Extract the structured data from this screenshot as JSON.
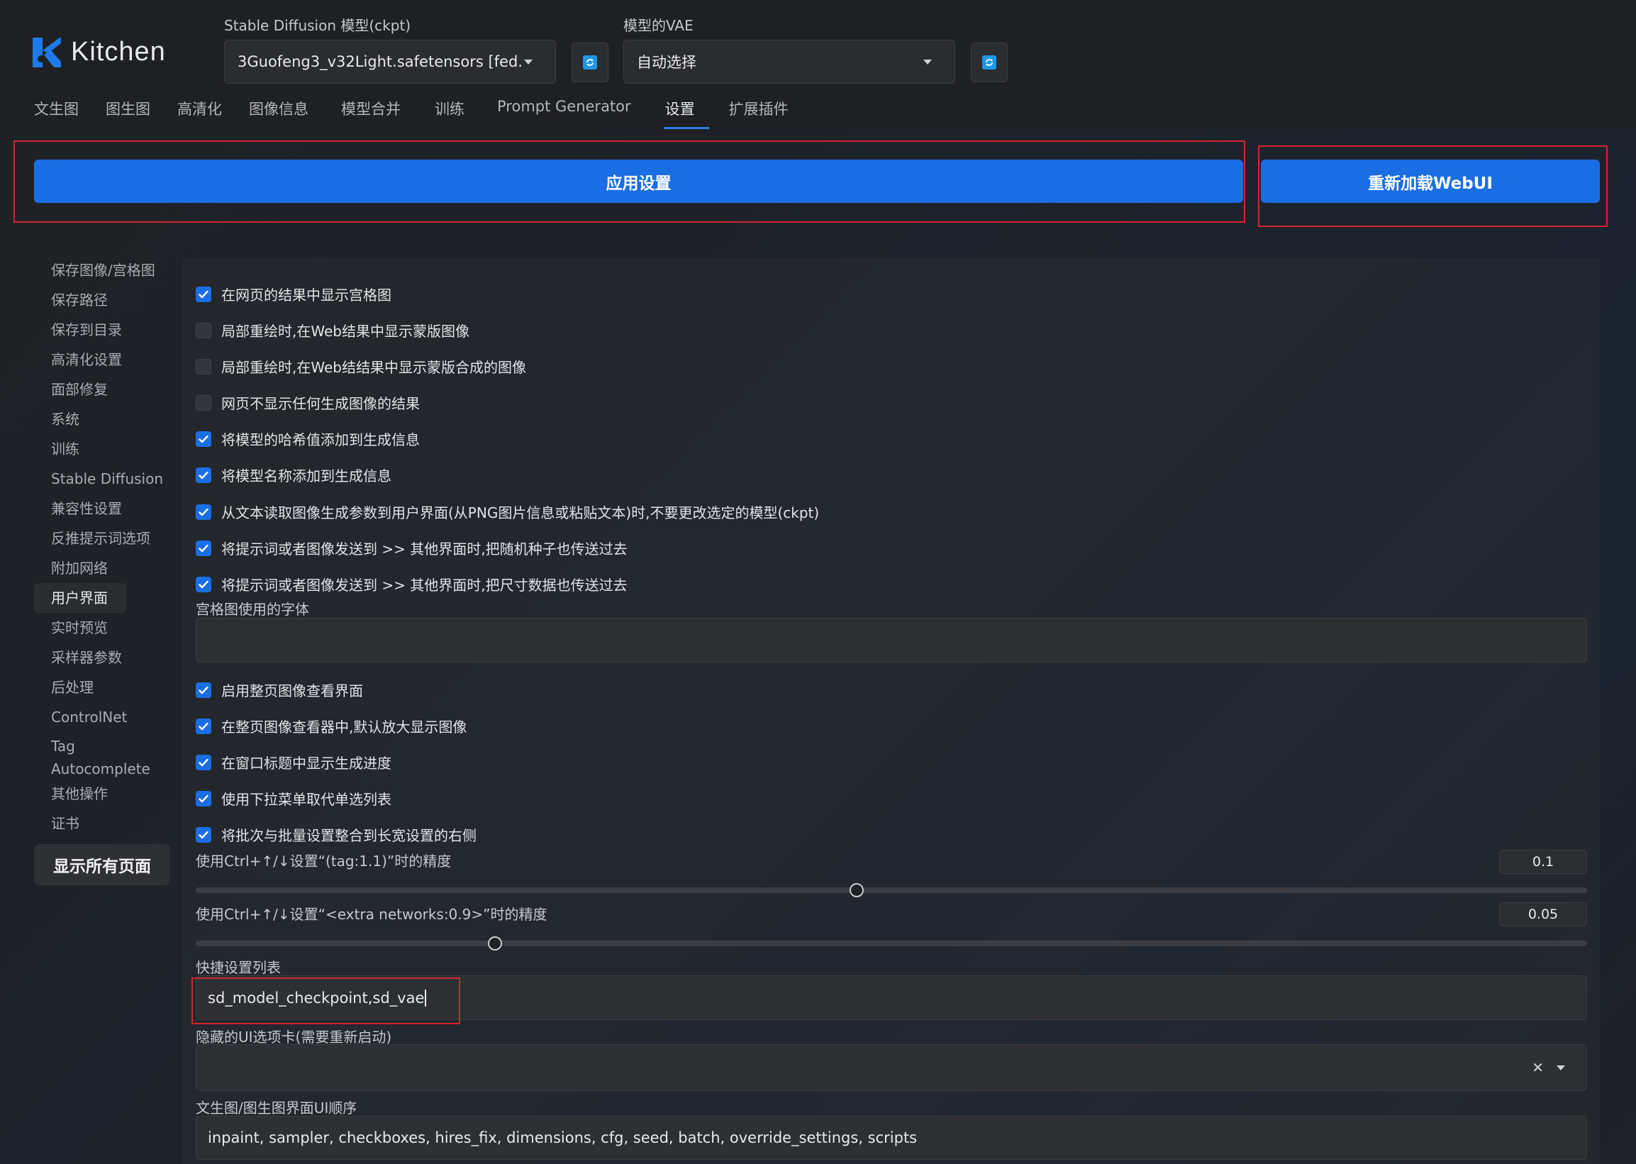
{
  "app": {
    "logo_text": "Kitchen"
  },
  "model": {
    "ckpt_label": "Stable Diffusion 模型(ckpt)",
    "ckpt_value": "3Guofeng3_v32Light.safetensors [fed...",
    "vae_label": "模型的VAE",
    "vae_value": "自动选择"
  },
  "tabs": [
    {
      "label": "文生图"
    },
    {
      "label": "图生图"
    },
    {
      "label": "高清化"
    },
    {
      "label": "图像信息"
    },
    {
      "label": "模型合并"
    },
    {
      "label": "训练"
    },
    {
      "label": "Prompt Generator"
    },
    {
      "label": "设置"
    },
    {
      "label": "扩展插件"
    }
  ],
  "active_tab": "设置",
  "actions": {
    "apply": "应用设置",
    "reload": "重新加载WebUI"
  },
  "sidebar": {
    "items": [
      "保存图像/宫格图",
      "保存路径",
      "保存到目录",
      "高清化设置",
      "面部修复",
      "系统",
      "训练",
      "Stable Diffusion",
      "兼容性设置",
      "反推提示词选项",
      "附加网络",
      "用户界面",
      "实时预览",
      "采样器参数",
      "后处理",
      "ControlNet",
      "Tag Autocomplete",
      "其他操作",
      "证书"
    ],
    "active": "用户界面",
    "show_all": "显示所有页面"
  },
  "settings": {
    "checkboxes_a": [
      {
        "label": "在网页的结果中显示宫格图",
        "checked": true
      },
      {
        "label": "局部重绘时,在Web结果中显示蒙版图像",
        "checked": false
      },
      {
        "label": "局部重绘时,在Web结结果中显示蒙版合成的图像",
        "checked": false
      },
      {
        "label": "网页不显示任何生成图像的结果",
        "checked": false
      },
      {
        "label": "将模型的哈希值添加到生成信息",
        "checked": true
      },
      {
        "label": "将模型名称添加到生成信息",
        "checked": true
      },
      {
        "label": "从文本读取图像生成参数到用户界面(从PNG图片信息或粘贴文本)时,不要更改选定的模型(ckpt)",
        "checked": true
      },
      {
        "label": "将提示词或者图像发送到 >> 其他界面时,把随机种子也传送过去",
        "checked": true
      },
      {
        "label": "将提示词或者图像发送到 >> 其他界面时,把尺寸数据也传送过去",
        "checked": true
      }
    ],
    "font_label": "宫格图使用的字体",
    "font_value": "",
    "checkboxes_b": [
      {
        "label": "启用整页图像查看界面",
        "checked": true
      },
      {
        "label": "在整页图像查看器中,默认放大显示图像",
        "checked": true
      },
      {
        "label": "在窗口标题中显示生成进度",
        "checked": true
      },
      {
        "label": "使用下拉菜单取代单选列表",
        "checked": true
      },
      {
        "label": "将批次与批量设置整合到长宽设置的右侧",
        "checked": true
      }
    ],
    "precision1_label": "使用Ctrl+↑/↓设置“(tag:1.1)”时的精度",
    "precision1_value": "0.1",
    "precision1_fraction": 0.475,
    "precision2_label": "使用Ctrl+↑/↓设置“<extra networks:0.9>”时的精度",
    "precision2_value": "0.05",
    "precision2_fraction": 0.215,
    "quick_label": "快捷设置列表",
    "quick_value": "sd_model_checkpoint,sd_vae",
    "hidden_label": "隐藏的UI选项卡(需要重新启动)",
    "hidden_value": "",
    "order_label": "文生图/图生图界面UI顺序",
    "order_value": "inpaint, sampler, checkboxes, hires_fix, dimensions, cfg, seed, batch, override_settings, scripts"
  },
  "colors": {
    "accent": "#1a6ee3",
    "highlight": "#d62430"
  }
}
